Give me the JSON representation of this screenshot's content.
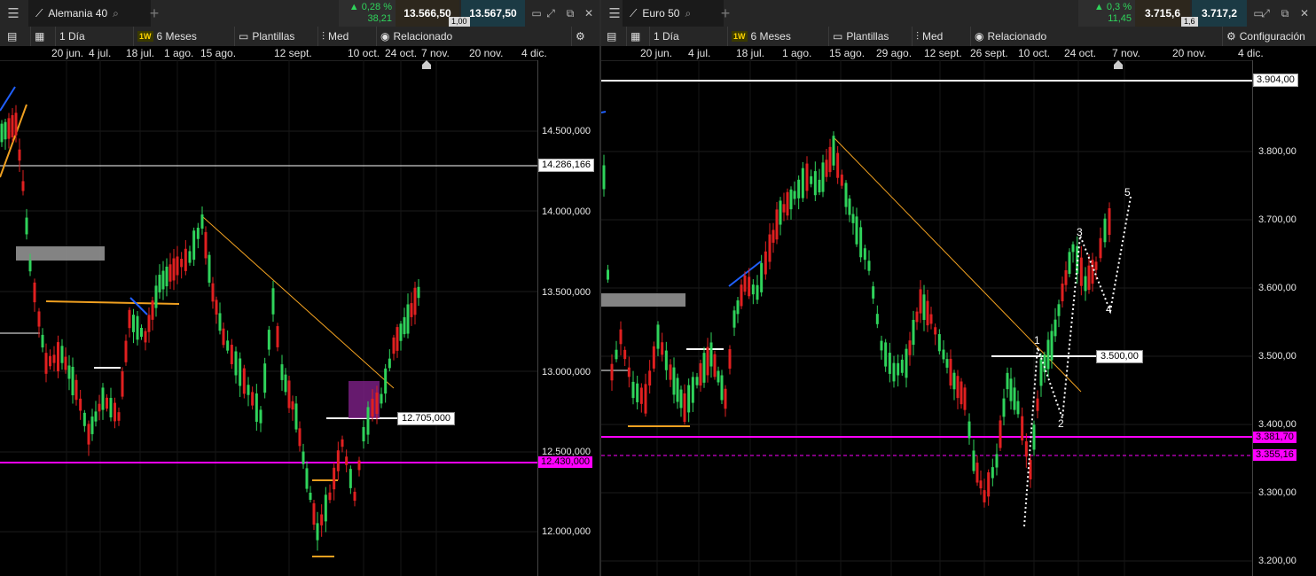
{
  "left": {
    "instrument": "Alemania 40",
    "change_pct": "0,28 %",
    "change_pts": "38,21",
    "bid": "13.566,50",
    "ask": "13.567,50",
    "spread": "1,00",
    "toolbar": {
      "interval": "1 Día",
      "badge": "1W",
      "range": "6 Meses",
      "templates": "Plantillas",
      "med": "Med",
      "related": "Relacionado"
    },
    "dates": [
      "20 jun.",
      "4 jul.",
      "18 jul.",
      "1 ago.",
      "15 ago.",
      "12 sept.",
      "10 oct.",
      "24 oct.",
      "7 nov.",
      "20 nov.",
      "4 dic."
    ],
    "yticks": [
      "14.500,000",
      "14.000,000",
      "13.500,000",
      "13.000,000",
      "12.500,000",
      "12.000,000"
    ],
    "tags": {
      "resistance": "14.286,166",
      "level_mid": "12.705,000",
      "support": "12.430,000"
    }
  },
  "right": {
    "instrument": "Euro 50",
    "change_pct": "0,3 %",
    "change_pts": "11,45",
    "bid": "3.715,6",
    "ask": "3.717,2",
    "spread": "1,6",
    "toolbar": {
      "interval": "1 Día",
      "badge": "1W",
      "range": "6 Meses",
      "templates": "Plantillas",
      "med": "Med",
      "related": "Relacionado",
      "settings": "Configuración"
    },
    "dates": [
      "20 jun.",
      "4 jul.",
      "18 jul.",
      "1 ago.",
      "15 ago.",
      "29 ago.",
      "12 sept.",
      "26 sept.",
      "10 oct.",
      "24 oct.",
      "7 nov.",
      "20 nov.",
      "4 dic."
    ],
    "yticks": [
      "3.800,00",
      "3.700,00",
      "3.600,00",
      "3.500,00",
      "3.400,00",
      "3.300,00",
      "3.200,00"
    ],
    "tags": {
      "top": "3.904,00",
      "level_mid": "3.500,00",
      "support1": "3.381,70",
      "support2": "3.355,16"
    },
    "wave_labels": [
      "1",
      "2",
      "3",
      "4",
      "5"
    ]
  },
  "colors": {
    "up": "#2fd35b",
    "down": "#e02020",
    "trend": "#f0a020",
    "magenta": "#ff00ff",
    "accent_blue": "#2060ff"
  }
}
